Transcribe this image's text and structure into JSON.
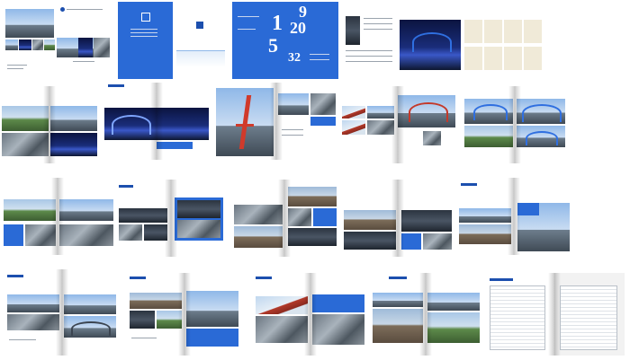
{
  "cover": {
    "big_numbers": [
      "1",
      "9",
      "20",
      "5",
      "32"
    ]
  },
  "colors": {
    "brand_blue": "#2a6ad6",
    "dark_blue": "#1c4fae",
    "bridge_red": "#c4392a"
  },
  "icons": [
    "bridge-photo",
    "company-logo"
  ]
}
